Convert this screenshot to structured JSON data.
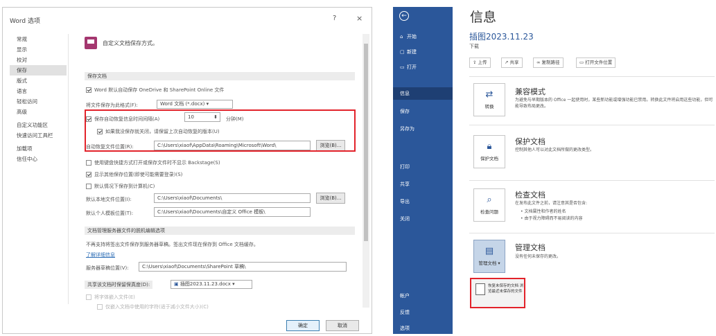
{
  "dialog": {
    "title": "Word 选项",
    "help": "?",
    "close": "×",
    "nav": [
      "常规",
      "显示",
      "校对",
      "保存",
      "版式",
      "语言",
      "轻松访问",
      "高级",
      "自定义功能区",
      "快速访问工具栏",
      "加载项",
      "信任中心"
    ],
    "header_text": "自定义文档保存方式。",
    "section_save": "保存文档",
    "onedrive_label": "Word 默认自动保存 OneDrive 和 SharePoint Online 文件",
    "format_label": "将文件保存为此格式(F):",
    "format_value": "Word 文档 (*.docx)",
    "autosave_label": "保存自动恢复信息时间间隔(A)",
    "autosave_minutes": "10",
    "autosave_unit": "分钟(M)",
    "keep_last_label": "如果我没保存就关闭，请保留上次自动恢复的版本(U)",
    "recover_path_label": "自动恢复文件位置(R):",
    "recover_path_value": "C:\\Users\\xiaof\\AppData\\Roaming\\Microsoft\\Word\\",
    "browse_label": "浏览(B)...",
    "no_backstage_label": "使用键盘快捷方式打开或保存文件时不显示 Backstage(S)",
    "show_more_label": "显示其他保存位置(即使可能需要登录)(S)",
    "default_local_label": "默认情况下保存到计算机(C)",
    "default_local_path_label": "默认本地文件位置(I):",
    "default_local_path_value": "C:\\Users\\xiaof\\Documents\\",
    "template_path_label": "默认个人模板位置(T):",
    "template_path_value": "C:\\Users\\xiaof\\Documents\\自定义 Office 模板\\",
    "section_offline": "文档管理服务器文件的脱机编辑选项",
    "offline_desc": "不再支持将签出文件保存到服务器草稿。签出文件现在保存到 Office 文档缓存。",
    "learn_more": "了解详细信息",
    "server_drafts_label": "服务器草稿位置(V):",
    "server_drafts_value": "C:\\Users\\xiaof\\Documents\\SharePoint 草稿\\",
    "section_fidelity": "共享该文档时保留保真度(D):",
    "fidelity_doc": "插图2023.11.23.docx",
    "embed_fonts_label": "将字体嵌入文件(E)",
    "embed_sub_label": "仅嵌入文档中使用的字符(适于减小文件大小)(C)",
    "ok_label": "确定",
    "cancel_label": "取消"
  },
  "backstage": {
    "back": "←",
    "nav": [
      {
        "icon": "⌂",
        "label": "开始"
      },
      {
        "icon": "▢",
        "label": "新建"
      },
      {
        "icon": "▭",
        "label": "打开"
      },
      {
        "icon": "",
        "label": "信息"
      },
      {
        "icon": "",
        "label": "保存"
      },
      {
        "icon": "",
        "label": "另存为"
      },
      {
        "icon": "",
        "label": "打印"
      },
      {
        "icon": "",
        "label": "共享"
      },
      {
        "icon": "",
        "label": "导出"
      },
      {
        "icon": "",
        "label": "关闭"
      },
      {
        "icon": "",
        "label": "帐户"
      },
      {
        "icon": "",
        "label": "反馈"
      },
      {
        "icon": "",
        "label": "选项"
      }
    ],
    "title": "信息",
    "doc_name": "插图2023.11.23",
    "doc_path": "下载",
    "buttons": [
      "上传",
      "共享",
      "复制路径",
      "打开文件位置"
    ],
    "compat": {
      "tile": "转换",
      "title": "兼容模式",
      "desc": "为避免与早期版本的 Office 一起使用时，某些新功能或增强功能已禁用。转换此文件将启用这些功能，但可能导致布局更改。"
    },
    "protect": {
      "tile": "保护文档",
      "title": "保护文档",
      "desc": "控制其他人可以对此文档所做的更改类型。"
    },
    "inspect": {
      "tile": "检查问题",
      "title": "检查文档",
      "desc": "在发布此文件之前，请注意其是否包含:",
      "bullets": [
        "文档属性和作者的姓名",
        "由于视力障碍而不易阅读的内容"
      ]
    },
    "manage": {
      "tile": "管理文档",
      "title": "管理文档",
      "desc": "没有任何未保存的更改。"
    },
    "popup": "恢复未保存的文档 浏览最近未保存的文件"
  }
}
